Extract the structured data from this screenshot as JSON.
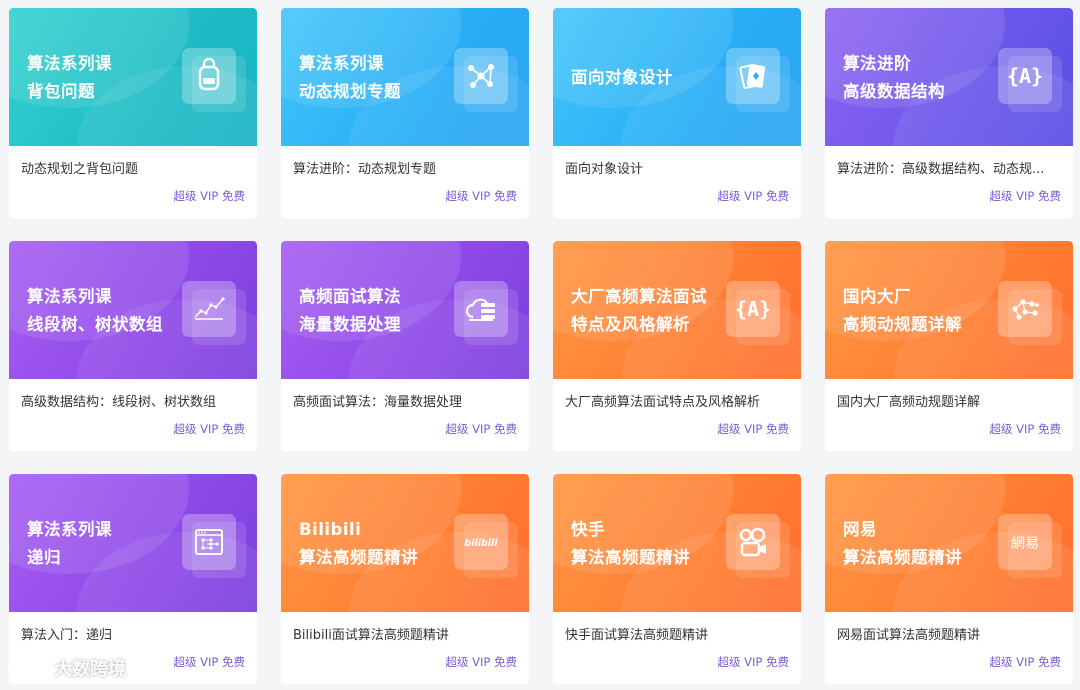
{
  "cards": [
    {
      "banner_line1": "算法系列课",
      "banner_line2": "背包问题",
      "name": "动态规划之背包问题",
      "badge": "超级 VIP 免费",
      "icon": "backpack-icon",
      "color": "teal"
    },
    {
      "banner_line1": "算法系列课",
      "banner_line2": "动态规划专题",
      "name": "算法进阶：动态规划专题",
      "badge": "超级 VIP 免费",
      "icon": "network-graph-icon",
      "color": "sky"
    },
    {
      "banner_line1": "面向对象设计",
      "name": "面向对象设计",
      "badge": "超级 VIP 免费",
      "icon": "cards-icon",
      "color": "sky"
    },
    {
      "banner_line1": "算法进阶",
      "banner_line2": "高级数据结构",
      "name": "算法进阶：高级数据结构、动态规...",
      "badge": "超级 VIP 免费",
      "icon": "brace-a-icon",
      "color": "indigo"
    },
    {
      "banner_line1": "算法系列课",
      "banner_line2": "线段树、树状数组",
      "name": "高级数据结构：线段树、树状数组",
      "badge": "超级 VIP 免费",
      "icon": "segment-tree-icon",
      "color": "purple"
    },
    {
      "banner_line1": "高频面试算法",
      "banner_line2": "海量数据处理",
      "name": "高频面试算法：海量数据处理",
      "badge": "超级 VIP 免费",
      "icon": "cloud-server-icon",
      "color": "purple"
    },
    {
      "banner_line1": "大厂高频算法面试",
      "banner_line2": "特点及风格解析",
      "name": "大厂高频算法面试特点及风格解析",
      "badge": "超级 VIP 免费",
      "icon": "brace-a-icon",
      "color": "orange"
    },
    {
      "banner_line1": "国内大厂",
      "banner_line2": "高频动规题详解",
      "name": "国内大厂高频动规题详解",
      "badge": "超级 VIP 免费",
      "icon": "dots-graph-icon",
      "color": "orange"
    },
    {
      "banner_line1": "算法系列课",
      "banner_line2": "递归",
      "name": "算法入门：递归",
      "badge": "超级 VIP 免费",
      "icon": "browser-tree-icon",
      "color": "purple"
    },
    {
      "banner_line1": "Bilibili",
      "banner_line2": "算法高频题精讲",
      "name": "Bilibili面试算法高频题精讲",
      "badge": "超级 VIP 免费",
      "icon": "bilibili-logo-icon",
      "color": "orange",
      "icon_text": "bilibili"
    },
    {
      "banner_line1": "快手",
      "banner_line2": "算法高频题精讲",
      "name": "快手面试算法高频题精讲",
      "badge": "超级 VIP 免费",
      "icon": "kuaishou-logo-icon",
      "color": "orange"
    },
    {
      "banner_line1": "网易",
      "banner_line2": "算法高频题精讲",
      "name": "网易面试算法高频题精讲",
      "badge": "超级 VIP 免费",
      "icon": "netease-logo-icon",
      "color": "orange",
      "icon_text": "網易"
    }
  ],
  "watermark": {
    "text": "大数跨境",
    "icon": "dashu-logo-icon"
  },
  "colors": {
    "teal": "#1fbcc6",
    "sky": "#29aef6",
    "indigo": "#6a56ea",
    "purple": "#8f49e8",
    "orange": "#ff7e33",
    "badge": "#7b5cd6"
  }
}
